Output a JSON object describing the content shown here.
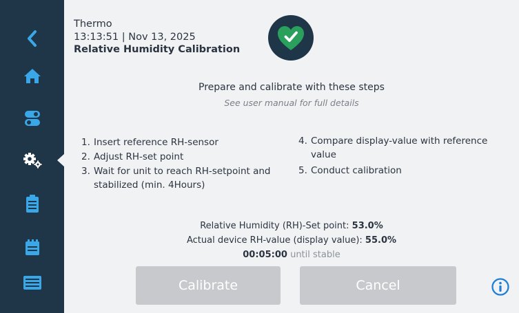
{
  "header": {
    "app_name": "Thermo",
    "datetime": "13:13:51 | Nov 13, 2025",
    "page_title": "Relative Humidity Calibration"
  },
  "status": {
    "icon": "heart-check-icon",
    "color": "#2aa05c"
  },
  "intro": {
    "heading": "Prepare and calibrate with these steps",
    "subheading": "See user manual for full details"
  },
  "steps_left": [
    {
      "num": "1.",
      "text": "Insert reference RH-sensor"
    },
    {
      "num": "2.",
      "text": "Adjust RH-set point"
    },
    {
      "num": "3.",
      "text": "Wait for unit to reach RH-setpoint and stabilized (min. 4Hours)"
    }
  ],
  "steps_right": [
    {
      "num": "4.",
      "text": "Compare display-value with reference value"
    },
    {
      "num": "5.",
      "text": "Conduct calibration"
    }
  ],
  "values": {
    "setpoint_label": "Relative Humidity (RH)-Set point:",
    "setpoint_value": "53.0%",
    "actual_label": "Actual device RH-value (display value):",
    "actual_value": "55.0%",
    "timer": "00:05:00",
    "timer_suffix": "until stable"
  },
  "buttons": {
    "calibrate": "Calibrate",
    "cancel": "Cancel"
  },
  "sidebar": {
    "items": [
      "back-arrow-icon",
      "home-icon",
      "toggle-switches-icon",
      "settings-gears-icon",
      "clipboard-icon",
      "calendar-icon",
      "screen-icon"
    ],
    "active": "settings-gears-icon"
  },
  "colors": {
    "sidebar_bg": "#1f3548",
    "accent": "#3aa8e8",
    "content_bg": "#f1f2f4",
    "button_disabled": "#c7c9cc",
    "info": "#1f7fd6"
  }
}
